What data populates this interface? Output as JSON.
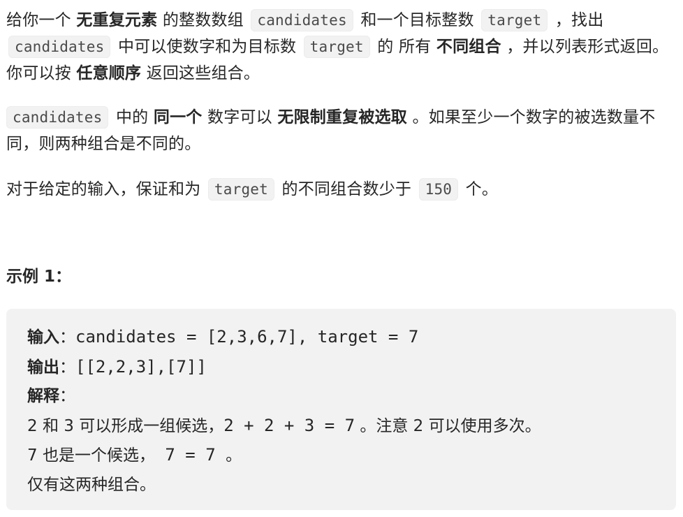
{
  "paragraph1": {
    "t1": "给你一个",
    "b1": "无重复元素",
    "t2": "的整数数组",
    "c1": "candidates",
    "t3": "和一个目标整数",
    "c2": "target",
    "t4": "，找出",
    "c3": "candidates",
    "t5": "中可以使数字和为目标数",
    "c4": "target",
    "t6": "的 所有",
    "b2": "不同组合",
    "t7": "，并以列表形式返回。你可以按",
    "b3": "任意顺序",
    "t8": "返回这些组合。"
  },
  "paragraph2": {
    "c1": "candidates",
    "t1": "中的",
    "b1": "同一个",
    "t2": "数字可以",
    "b2": "无限制重复被选取",
    "t3": "。如果至少一个数字的被选数量不同，则两种组合是不同的。"
  },
  "paragraph3": {
    "t1": "对于给定的输入，保证和为",
    "c1": "target",
    "t2": "的不同组合数少于",
    "c2": "150",
    "t3": "个。"
  },
  "example": {
    "title": "示例 1：",
    "input_label": "输入",
    "input_colon": "：",
    "input_value": "candidates = [2,3,6,7], target = 7",
    "output_label": "输出",
    "output_colon": "：",
    "output_value": "[[2,2,3],[7]]",
    "explain_label": "解释",
    "explain_colon": "：",
    "explain_line1_a": "2 和 3 可以形成一组候选，",
    "explain_line1_b": "2 + 2 + 3 = 7",
    "explain_line1_c": " 。注意 2 可以使用多次。",
    "explain_line2_a": "7 也是一个候选，",
    "explain_line2_b": " 7 = 7 ",
    "explain_line2_c": "。",
    "explain_line3": "仅有这两种组合。"
  }
}
